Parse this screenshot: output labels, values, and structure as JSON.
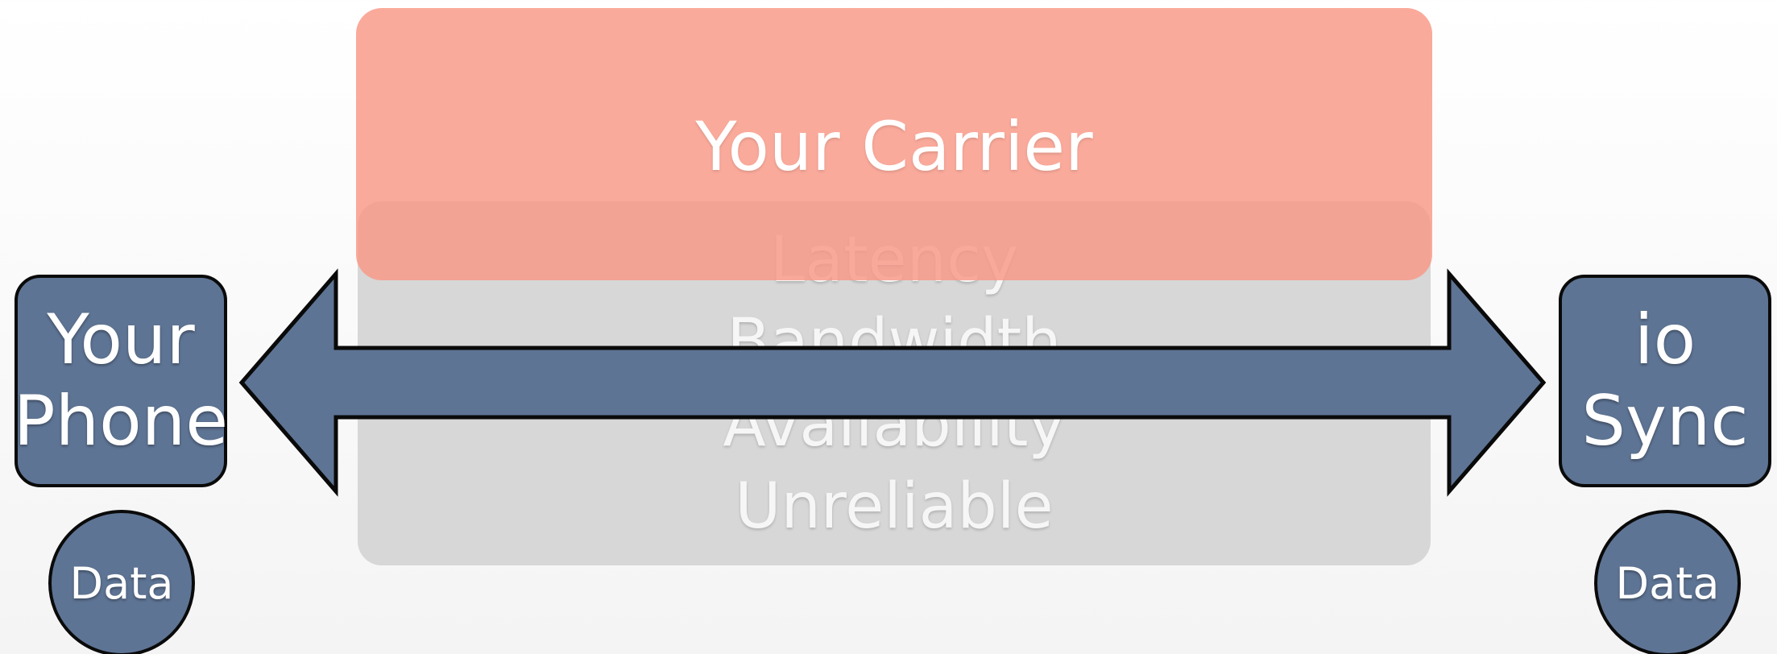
{
  "carrier": {
    "label": "Your Carrier"
  },
  "issues": [
    "Latency",
    "Bandwidth",
    "Availability",
    "Unreliable"
  ],
  "left_node": {
    "label": "Your\nPhone",
    "data_label": "Data"
  },
  "right_node": {
    "label": "io\nSync",
    "data_label": "Data"
  },
  "colors": {
    "node_fill": "#5e7494",
    "carrier_fill": "#f99785",
    "issues_panel": "#d7d7d7"
  }
}
